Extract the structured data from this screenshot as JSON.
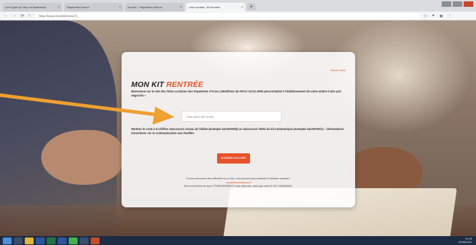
{
  "browser": {
    "tabs": [
      {
        "label": "Les Types de Jeux au Badminton",
        "active": false
      },
      {
        "label": "Papeteries d'Arvor",
        "active": false
      },
      {
        "label": "Accueil – Papeteries d'Arvor",
        "active": false
      },
      {
        "label": "Liste scolaire, Kit Rentrée",
        "active": true
      }
    ],
    "new_tab": "+",
    "url": "https://www.monkitrentree.fr",
    "nav_back": "←",
    "nav_forward": "→",
    "nav_reload": "⟳",
    "nav_home": "⌂"
  },
  "card": {
    "help_link": "Besoin d'aide",
    "title_main": "MON KIT ",
    "title_accent": "RENTRÉE",
    "intro": "Bienvenue sur le site des listes scolaires des Papeteries d'Arvor, bénéficiez du PACK SCOLAIRE personnalisé à l'établissement de votre enfant à des prix négociés !",
    "input_placeholder": "Code fourni par l'école",
    "instructions": "Rentrez le code à 8 chiffres 411xxxxx/x niveau de l'élève (exemple 41100000/6) ou 411xxxxx/x lettre du kit communiqué (exemple 41100000/A) – informations transmises sur la communication aux familles",
    "submit_label": "ACCÉDER À SA LISTE",
    "footer_line1": "Si vous rencontrez des difficultés sur ce site, vous pouvez nous contacter à l'adresse suivante :",
    "footer_email": "monkitrentree@arvor.fr",
    "footer_line2": "Merci de préciser de quel L'ÉTABLISSEMENT vous dépendez, ainsi que votre N° DE COMMANDE."
  },
  "taskbar": {
    "clock_time": "11:43",
    "clock_date": "21/06/2021"
  },
  "colors": {
    "accent": "#e8522a",
    "arrow": "#f0a030"
  }
}
